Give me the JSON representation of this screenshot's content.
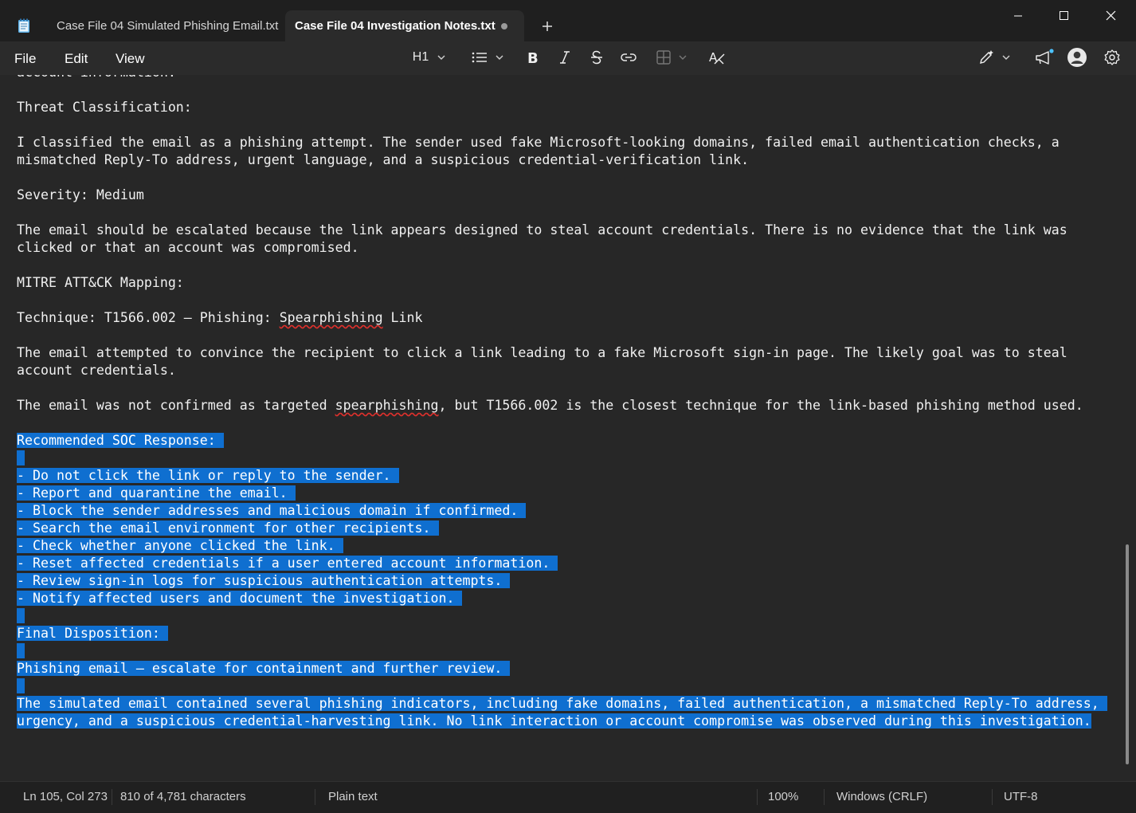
{
  "tabs": [
    {
      "label": "Case File 04 Simulated Phishing Email.txt"
    },
    {
      "label": "Case File 04 Investigation Notes.txt"
    }
  ],
  "menu": {
    "file": "File",
    "edit": "Edit",
    "view": "View"
  },
  "toolbar": {
    "heading": "H1"
  },
  "editor": {
    "lines": [
      {
        "text": "account information."
      },
      {
        "text": ""
      },
      {
        "text": "Threat Classification:"
      },
      {
        "text": ""
      },
      {
        "text": "I classified the email as a phishing attempt. The sender used fake Microsoft-looking domains, failed email authentication checks, a"
      },
      {
        "text": "mismatched Reply-To address, urgent language, and a suspicious credential-verification link."
      },
      {
        "text": ""
      },
      {
        "text": "Severity: Medium"
      },
      {
        "text": ""
      },
      {
        "text": "The email should be escalated because the link appears designed to steal account credentials. There is no evidence that the link was"
      },
      {
        "text": "clicked or that an account was compromised."
      },
      {
        "text": ""
      },
      {
        "text": "MITRE ATT&CK Mapping:"
      },
      {
        "text": ""
      },
      {
        "text": "Technique: T1566.002 — Phishing: ",
        "squiggle": "Spearphishing",
        "after": " Link"
      },
      {
        "text": ""
      },
      {
        "text": "The email attempted to convince the recipient to click a link leading to a fake Microsoft sign-in page. The likely goal was to steal"
      },
      {
        "text": "account credentials."
      },
      {
        "text": ""
      },
      {
        "text": "The email was not confirmed as targeted ",
        "squiggle": "spearphishing",
        "after": ", but T1566.002 is the closest technique for the link-based phishing method used."
      },
      {
        "text": ""
      },
      {
        "text": "Recommended SOC Response: ",
        "selected": true
      },
      {
        "text": " ",
        "selected": true
      },
      {
        "text": "- Do not click the link or reply to the sender. ",
        "selected": true
      },
      {
        "text": "- Report and quarantine the email. ",
        "selected": true
      },
      {
        "text": "- Block the sender addresses and malicious domain if confirmed. ",
        "selected": true
      },
      {
        "text": "- Search the email environment for other recipients. ",
        "selected": true
      },
      {
        "text": "- Check whether anyone clicked the link. ",
        "selected": true
      },
      {
        "text": "- Reset affected credentials if a user entered account information. ",
        "selected": true
      },
      {
        "text": "- Review sign-in logs for suspicious authentication attempts. ",
        "selected": true
      },
      {
        "text": "- Notify affected users and document the investigation. ",
        "selected": true
      },
      {
        "text": " ",
        "selected": true
      },
      {
        "text": "Final Disposition: ",
        "selected": true
      },
      {
        "text": " ",
        "selected": true
      },
      {
        "text": "Phishing email — escalate for containment and further review. ",
        "selected": true
      },
      {
        "text": " ",
        "selected": true
      },
      {
        "text": "The simulated email contained several phishing indicators, including fake domains, failed authentication, a mismatched Reply-To address, ",
        "selected": true
      },
      {
        "text": "urgency, and a suspicious credential-harvesting link. No link interaction or account compromise was observed during this investigation.",
        "selected": true
      }
    ]
  },
  "status": {
    "position": "Ln 105, Col 273",
    "characters": "810 of 4,781 characters",
    "format": "Plain text",
    "zoom": "100%",
    "line_ending": "Windows (CRLF)",
    "encoding": "UTF-8"
  },
  "colors": {
    "selection": "#0f6fd0",
    "background": "#272727",
    "accent": "#4cc2ff"
  }
}
